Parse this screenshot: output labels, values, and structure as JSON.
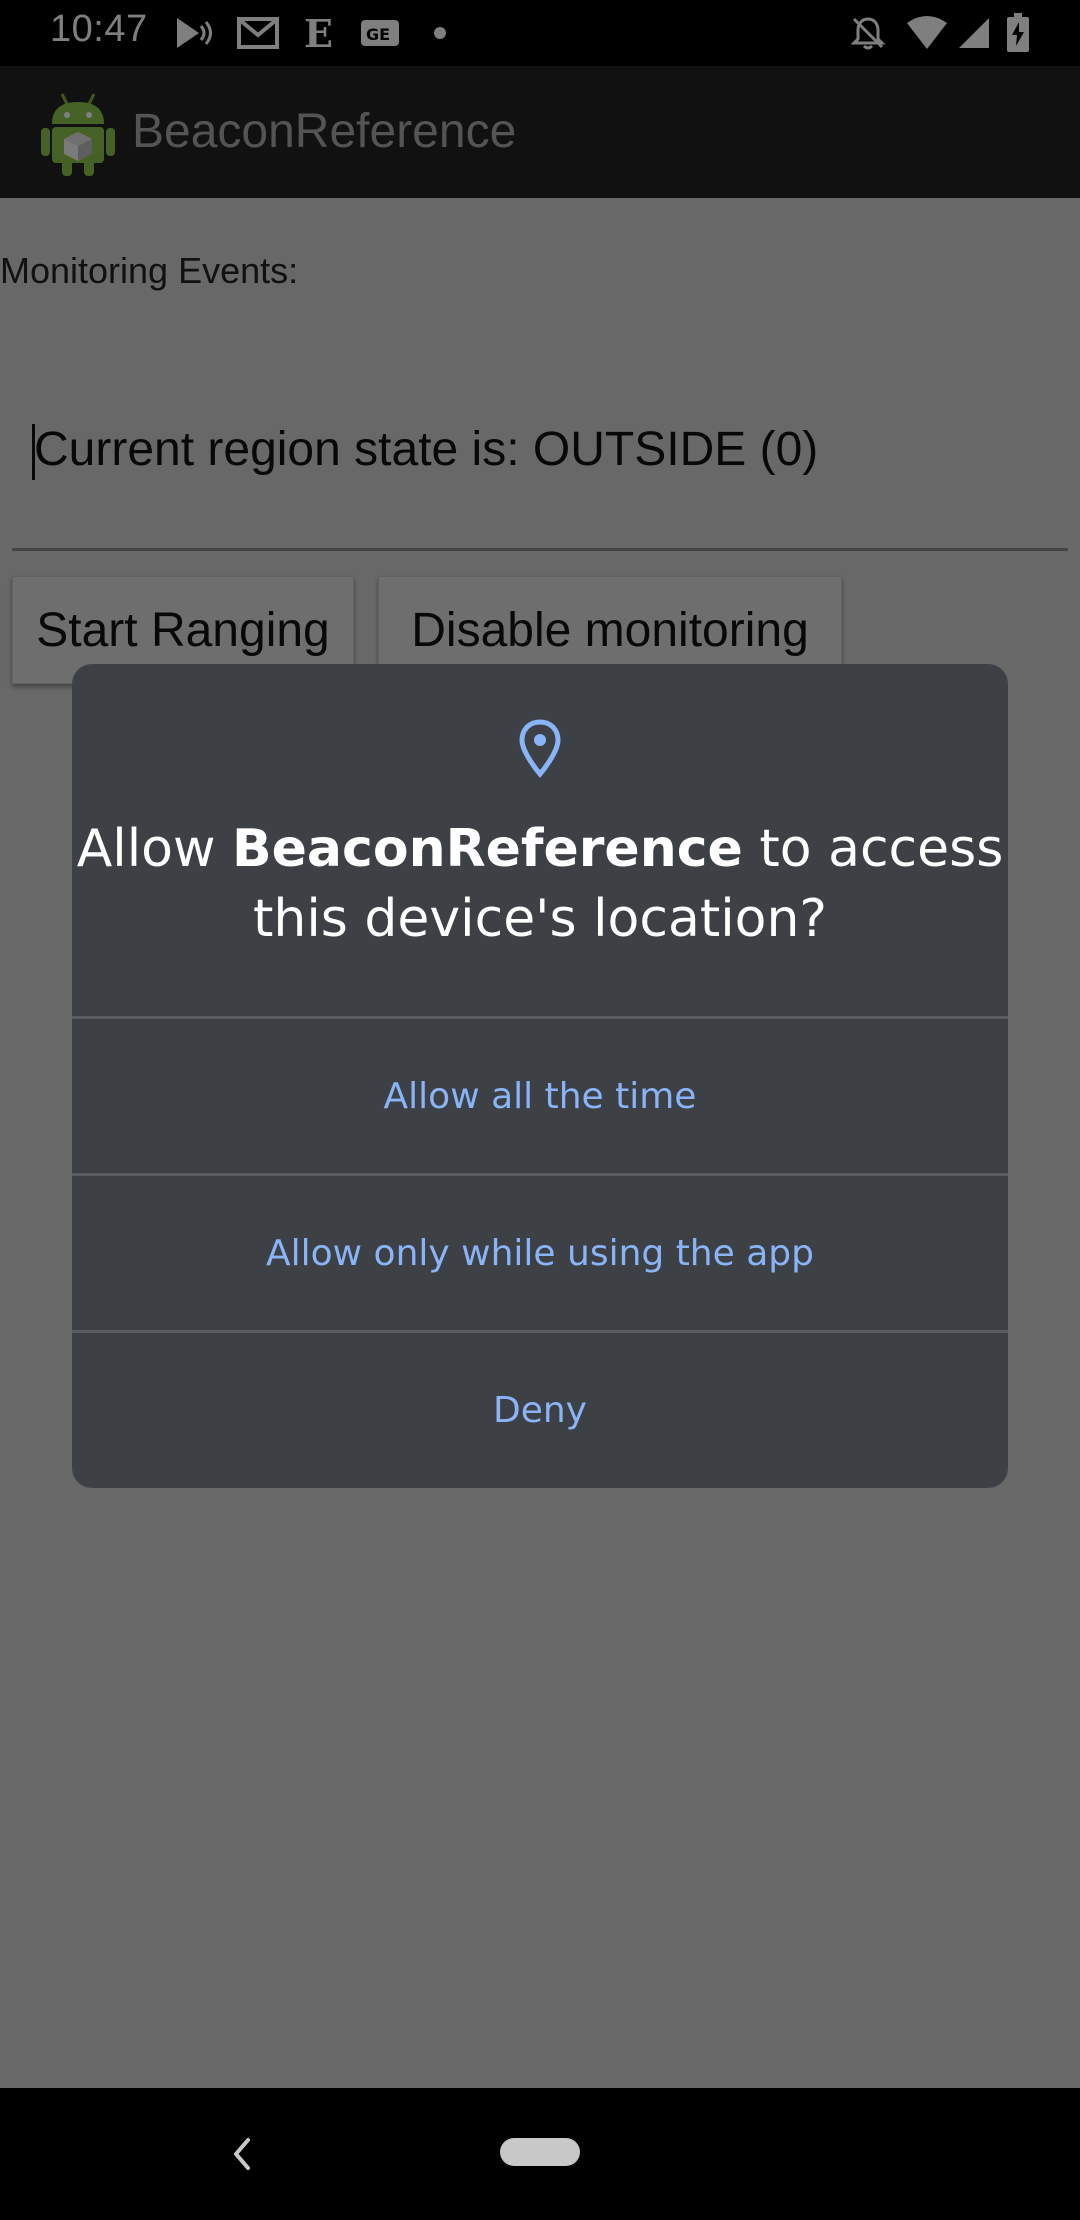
{
  "status_bar": {
    "time": "10:47",
    "left_icons": [
      "play-store-icon",
      "gmail-icon",
      "e-app-icon",
      "ge-app-icon",
      "dot-icon"
    ],
    "right_icons": [
      "bell-off-icon",
      "wifi-icon",
      "signal-icon",
      "battery-charging-icon"
    ]
  },
  "app_bar": {
    "title": "BeaconReference",
    "logo_icon": "android-robot-icon"
  },
  "content": {
    "monitoring_label": "Monitoring Events:",
    "region_state": "Current region state is: OUTSIDE (0)",
    "start_ranging_label": "Start Ranging",
    "disable_monitoring_label": "Disable monitoring"
  },
  "dialog": {
    "icon": "location-pin-icon",
    "title_prefix": "Allow ",
    "title_app": "BeaconReference",
    "title_suffix": " to access this device's location?",
    "buttons": {
      "allow_all": "Allow all the time",
      "allow_while_using": "Allow only while using the app",
      "deny": "Deny"
    },
    "accent_color": "#8ab4f8"
  },
  "nav_bar": {
    "back_icon": "back-chevron-icon",
    "home_icon": "home-pill-icon"
  }
}
